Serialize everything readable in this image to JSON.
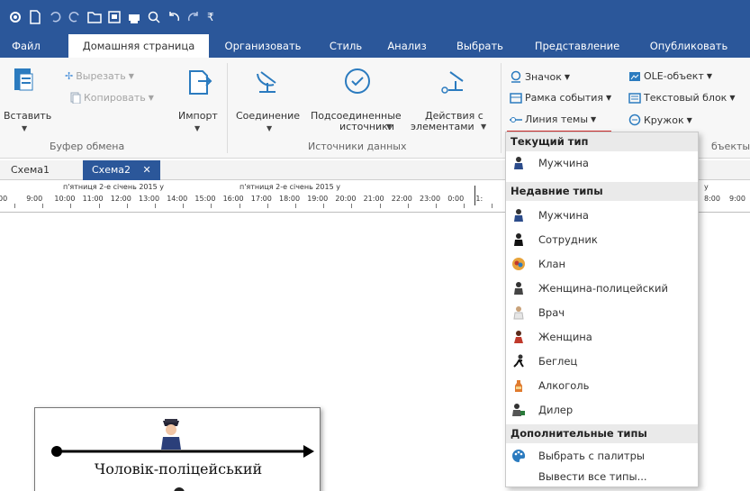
{
  "quick_access": {
    "icons": [
      "settings-icon",
      "new-document-icon",
      "undo-icon",
      "redo-icon",
      "folder-icon",
      "save-icon",
      "print-icon",
      "search-icon",
      "undo-arrow-icon",
      "redo-arrow-icon"
    ],
    "customize": "₹"
  },
  "tabs": [
    {
      "label": "Файл"
    },
    {
      "label": "Домашняя страница"
    },
    {
      "label": "Организовать"
    },
    {
      "label": "Стиль"
    },
    {
      "label": "Анализ"
    },
    {
      "label": "Выбрать"
    },
    {
      "label": "Представление"
    },
    {
      "label": "Опубликовать"
    }
  ],
  "ribbon": {
    "clipboard": {
      "paste": "Вставить",
      "cut": "Вырезать",
      "copy": "Копировать",
      "import": "Импорт",
      "group_label": "Буфер обмена"
    },
    "data_sources": {
      "connection": "Соединение",
      "connected_sources": "Подсоединенные",
      "connected_sources_2": "источники",
      "element_actions": "Действия с",
      "element_actions_2": "элементами",
      "group_label": "Источники данных"
    },
    "objects": {
      "icon": "Значок",
      "event_frame": "Рамка события",
      "theme_line": "Линия темы",
      "ole_object": "OLE-объект",
      "text_block": "Текстовый блок",
      "circle": "Кружок",
      "group_label_partial": "бъекты"
    }
  },
  "doc_tabs": [
    {
      "label": "Схема1"
    },
    {
      "label": "Схема2",
      "close": "✕"
    }
  ],
  "ruler": {
    "date1": "п'ятниця 2-е січень 2015 у",
    "date2": "п'ятниця 2-е січень 2015 у",
    "date_right_partial": "у",
    "hours": [
      "00",
      "9:00",
      "10:00",
      "11:00",
      "12:00",
      "13:00",
      "14:00",
      "15:00",
      "16:00",
      "17:00",
      "18:00",
      "19:00",
      "20:00",
      "21:00",
      "22:00",
      "23:00",
      "0:00",
      "1:"
    ],
    "hours_right": [
      "8:00",
      "9:00"
    ]
  },
  "canvas": {
    "card_label": "Чоловік-поліцейський"
  },
  "dropdown": {
    "current_header": "Текущий тип",
    "current_item": "Мужчина",
    "recent_header": "Недавние типы",
    "recent_items": [
      "Мужчина",
      "Сотрудник",
      "Клан",
      "Женщина-полицейский",
      "Врач",
      "Женщина",
      "Беглец",
      "Алкоголь",
      "Дилер"
    ],
    "more_header": "Дополнительные типы",
    "palette": "Выбрать с палитры",
    "show_all": "Вывести все типы..."
  },
  "colors": {
    "brand": "#2b579a",
    "accent_underline": "#d32f2f",
    "ribbon_bg": "#f7f7f7"
  }
}
